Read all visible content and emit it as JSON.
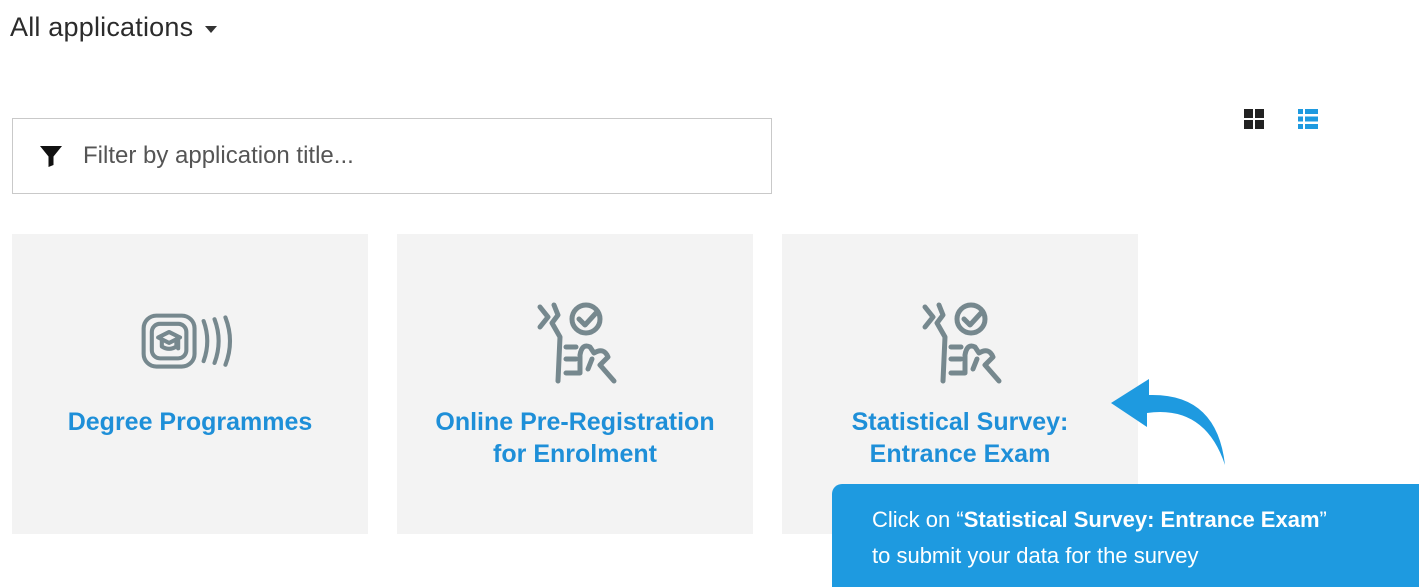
{
  "header": {
    "title": "All applications",
    "dropdown_icon": "caret-down-icon"
  },
  "view_toggle": {
    "grid_icon": "grid-view-icon",
    "list_icon": "list-view-icon",
    "active": "list",
    "active_color": "#1e9ae0"
  },
  "filter": {
    "placeholder": "Filter by application title...",
    "icon": "filter-icon"
  },
  "tiles": [
    {
      "label_line1": "Degree Programmes",
      "label_line2": "",
      "icon": "graduation-cap-icon"
    },
    {
      "label_line1": "Online Pre-Registration",
      "label_line2": "for Enrolment",
      "icon": "survey-check-icon"
    },
    {
      "label_line1": "Statistical Survey:",
      "label_line2": "Entrance Exam",
      "icon": "survey-check-icon"
    }
  ],
  "callout": {
    "prefix": "Click on “",
    "emphasis": "Statistical Survey: Entrance Exam",
    "suffix": "”",
    "line2": "to submit your data for the survey"
  },
  "colors": {
    "accent": "#1e8fd8",
    "callout_bg": "#1e9ae0",
    "tile_bg": "#f3f3f3",
    "icon_gray": "#76888e"
  }
}
